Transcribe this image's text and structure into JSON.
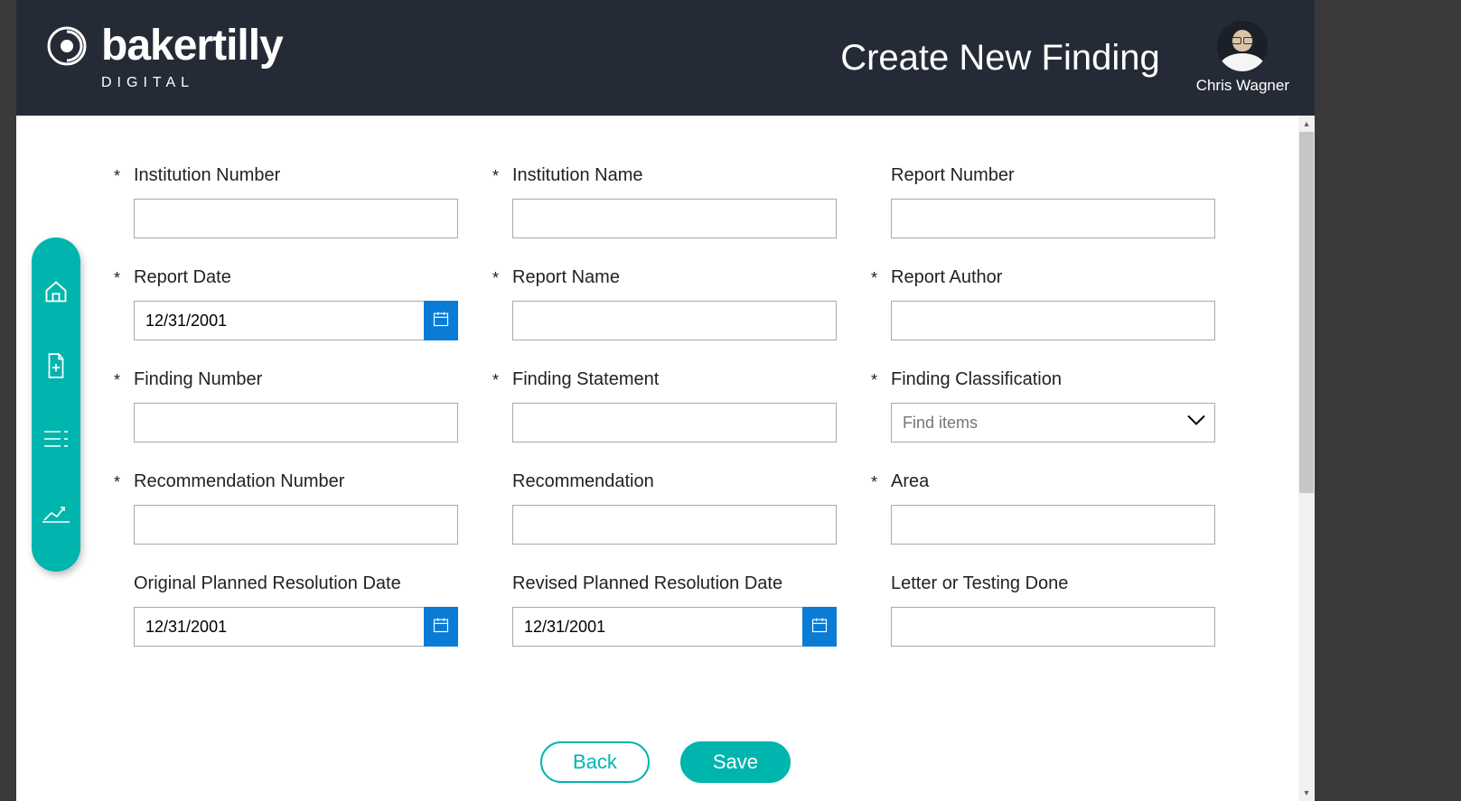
{
  "brand": {
    "name": "bakertilly",
    "sub": "DIGITAL"
  },
  "page": {
    "title": "Create New Finding"
  },
  "user": {
    "name": "Chris Wagner"
  },
  "sidebar": {
    "items": [
      {
        "name": "home"
      },
      {
        "name": "new-document"
      },
      {
        "name": "list"
      },
      {
        "name": "chart"
      }
    ]
  },
  "form": {
    "institution_number": {
      "label": "Institution Number",
      "required": true,
      "value": ""
    },
    "institution_name": {
      "label": "Institution Name",
      "required": true,
      "value": ""
    },
    "report_number": {
      "label": "Report Number",
      "required": false,
      "value": ""
    },
    "report_date": {
      "label": "Report Date",
      "required": true,
      "value": "12/31/2001"
    },
    "report_name": {
      "label": "Report Name",
      "required": true,
      "value": ""
    },
    "report_author": {
      "label": "Report Author",
      "required": true,
      "value": ""
    },
    "finding_number": {
      "label": "Finding Number",
      "required": true,
      "value": ""
    },
    "finding_statement": {
      "label": "Finding Statement",
      "required": true,
      "value": ""
    },
    "finding_classification": {
      "label": "Finding Classification",
      "required": true,
      "placeholder": "Find items"
    },
    "recommendation_number": {
      "label": "Recommendation Number",
      "required": true,
      "value": ""
    },
    "recommendation": {
      "label": "Recommendation",
      "required": false,
      "value": ""
    },
    "area": {
      "label": "Area",
      "required": true,
      "value": ""
    },
    "original_resolution_date": {
      "label": "Original Planned Resolution Date",
      "required": false,
      "value": "12/31/2001"
    },
    "revised_resolution_date": {
      "label": "Revised Planned Resolution Date",
      "required": false,
      "value": "12/31/2001"
    },
    "letter_testing": {
      "label": "Letter or Testing Done",
      "required": false,
      "value": ""
    }
  },
  "buttons": {
    "back": "Back",
    "save": "Save"
  }
}
